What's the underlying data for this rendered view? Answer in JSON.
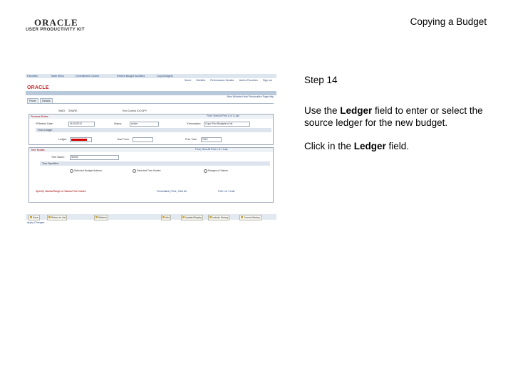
{
  "logo": {
    "word": "ORACLE",
    "sub": "USER PRODUCTIVITY KIT"
  },
  "doc_title": "Copying a Budget",
  "step_label": "Step 14",
  "instruction": {
    "part1": "Use the ",
    "bold1": "Ledger",
    "part2": " field to enter or select the source ledger for the new budget."
  },
  "action": {
    "part1": "Click in the ",
    "bold1": "Ledger",
    "part2": " field."
  },
  "screenshot": {
    "breadcrumbs": [
      "Favorites",
      "Main Menu",
      "Commitment Control",
      "Review Budget Activities",
      "Copy Budgets"
    ],
    "brand": "ORACLE",
    "top_links": [
      "Home",
      "Worklist",
      "Performance Monitor",
      "Add to Favorites",
      "Sign out"
    ],
    "nav_links": [
      "New Window",
      "Help",
      "Personalize Page",
      "http"
    ],
    "tabs": [
      "Panel",
      "Details"
    ],
    "top_row": {
      "setid_label": "SetID:",
      "setid_value": "SHARE",
      "run_label": "Run Control ID:",
      "run_value": "COPY"
    },
    "process_rules": {
      "header": "Process Rules",
      "nav": "Find | View All     First  1 of 1  Last",
      "request_label": "*Effective Date:",
      "request_value": "01/01/2012",
      "status_label": "Status:",
      "status_value": "Active",
      "desc_label": "*Description:",
      "desc_value": "Copy Prior Budgets to Ne",
      "subhead": "From Ledger",
      "ledger_label": "Ledger:",
      "ledger_value": "",
      "year_label": "Year From:",
      "year_value": "",
      "period_label": "Prior Year:",
      "period_value": "2013"
    },
    "trees": {
      "header": "Tree Nodes",
      "nav": "Find | View All     First  1 of 1  Last",
      "tree_label": "Tree Name:",
      "tree_value": "Select",
      "subhead": "Tree Specified",
      "radio1": "Selected Budget Actions",
      "radio2": "Selected Tree Nodes",
      "radio3": "Ranges of Values",
      "ranges_header": "Specify Values/Range of Values/Tree Nodes",
      "ranges_nav": "Personalize | Find | View All",
      "ranges_page": "First  1 of 1  Last"
    },
    "buttons_left": [
      "Save",
      "Return to List",
      "Refresh"
    ],
    "buttons_right": [
      "Add",
      "Update/Display",
      "Include History",
      "Correct History"
    ],
    "apply": "Apply Changes"
  }
}
